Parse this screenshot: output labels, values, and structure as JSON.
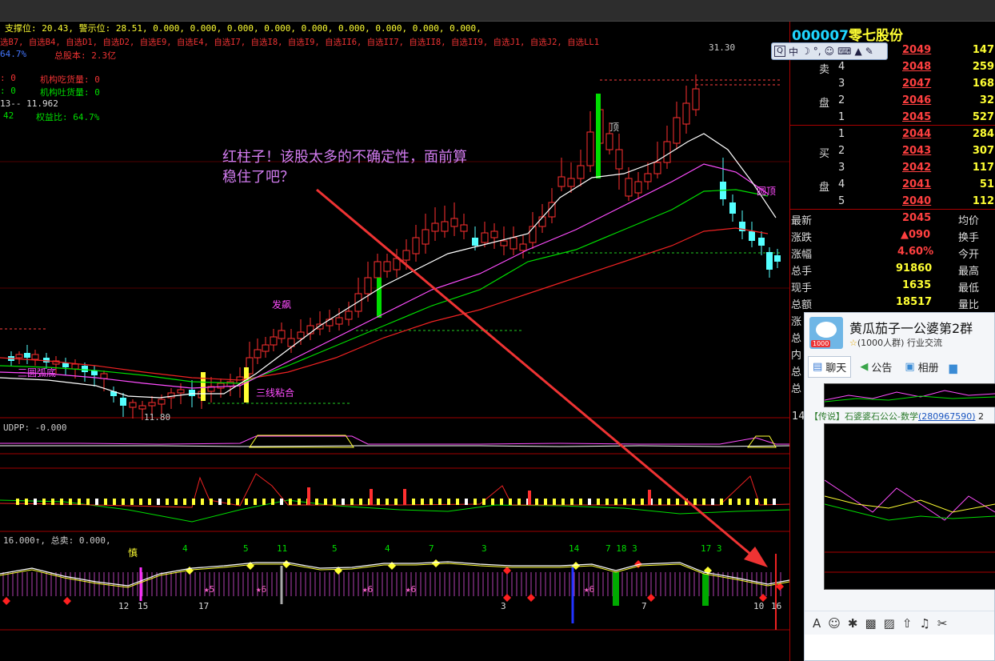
{
  "chart_header": {
    "line1": "支撑位: 20.43, 警示位: 28.51, 0.000, 0.000, 0.000, 0.000, 0.000, 0.000, 0.000, 0.000, 0.000,",
    "line2": "选B7, 自选B4, 自选D1, 自选D2, 自选E9, 自选E4, 自选I7, 自选I8, 自选I9, 自选II6, 自选II7, 自选II8, 自选II9, 自选J1, 自选J2, 自选LL1",
    "line3_a": "64.7%",
    "line3_b": "总股本: 2.3亿",
    "line4_a": ": 0",
    "line4_b": "机构吃货量: 0",
    "line5_a": ": 0",
    "line5_b": "机构吐货量: 0",
    "line6": "13-- 11.962",
    "line7_a": "42",
    "line7_b": "权益比: 64.7%"
  },
  "annotation": {
    "line1": "红柱子！该股太多的不确定性，面前算",
    "line2": "稳住了吧？"
  },
  "chart_labels": {
    "high_price": "31.30",
    "low_price": "11.80",
    "three_line": "三线粘合",
    "bottom_pattern": "三圆弧底",
    "fa_biao": "发飙",
    "top_pattern": "圆顶",
    "top_label": "顶",
    "udpp": "UDPP: -0.000",
    "sub3_header": "16.000↑, 总卖: 0.000,",
    "shen": "慎"
  },
  "sub3_numbers": [
    "4",
    "5",
    "11",
    "5",
    "4",
    "7",
    "3",
    "14",
    "7 18 3",
    "17 3"
  ],
  "sub3_bottom_numbers": [
    "12",
    "15",
    "17",
    "3",
    "7",
    "10",
    "16"
  ],
  "sub3_star_numbers": [
    "5",
    "6",
    "6",
    "6",
    "6"
  ],
  "stock": {
    "code": "000007",
    "name": "零七股份"
  },
  "toolbar_icons": [
    "qq-icon",
    "zhong-label",
    "moon-icon",
    "comma-icon",
    "smile-icon",
    "keyboard-icon",
    "shirt-icon",
    "wrench-icon"
  ],
  "toolbar_zhong": "中",
  "sell_label_1": "卖",
  "sell_label_2": "盘",
  "buy_label_1": "买",
  "buy_label_2": "盘",
  "sell_orders": [
    {
      "level": "5",
      "price": "2049",
      "volume": "147"
    },
    {
      "level": "4",
      "price": "2048",
      "volume": "259"
    },
    {
      "level": "3",
      "price": "2047",
      "volume": "168"
    },
    {
      "level": "2",
      "price": "2046",
      "volume": "32"
    },
    {
      "level": "1",
      "price": "2045",
      "volume": "527"
    }
  ],
  "buy_orders": [
    {
      "level": "1",
      "price": "2044",
      "volume": "284"
    },
    {
      "level": "2",
      "price": "2043",
      "volume": "307"
    },
    {
      "level": "3",
      "price": "2042",
      "volume": "117"
    },
    {
      "level": "4",
      "price": "2041",
      "volume": "51"
    },
    {
      "level": "5",
      "price": "2040",
      "volume": "112"
    }
  ],
  "stats": [
    {
      "label": "最新",
      "value": "2045",
      "label2": "均价"
    },
    {
      "label": "涨跌",
      "value": "▲090",
      "label2": "换手"
    },
    {
      "label": "涨幅",
      "value": "4.60%",
      "label2": "今开"
    },
    {
      "label": "总手",
      "value": "91860",
      "label2": "最高"
    },
    {
      "label": "现手",
      "value": "1635",
      "label2": "最低"
    },
    {
      "label": "总额",
      "value": "18517",
      "label2": "量比"
    }
  ],
  "stats_hidden_labels": [
    "涨",
    "总",
    "内",
    "总",
    "总"
  ],
  "panel_num": "14",
  "qq": {
    "group_name": "黄瓜茄子一公婆第2群",
    "member_info": "(1000人群) 行业交流",
    "avatar_badge": "1000",
    "tabs": [
      "聊天",
      "公告",
      "相册"
    ],
    "message_prefix": "【传说】石婆婆石公公-数学",
    "message_qq": "(280967590)",
    "message_suffix": "2"
  },
  "colors": {
    "up": "#ff3030",
    "down": "#54ffff",
    "ma_white": "#ffffff",
    "ma_magenta": "#ff4dff",
    "ma_green": "#00dd00",
    "ma_red": "#ee2222",
    "code": "#1fd6ff",
    "price": "#ff4040",
    "volume": "#ffff33",
    "annotation": "#d27cf0",
    "arrow": "#ee3333"
  }
}
